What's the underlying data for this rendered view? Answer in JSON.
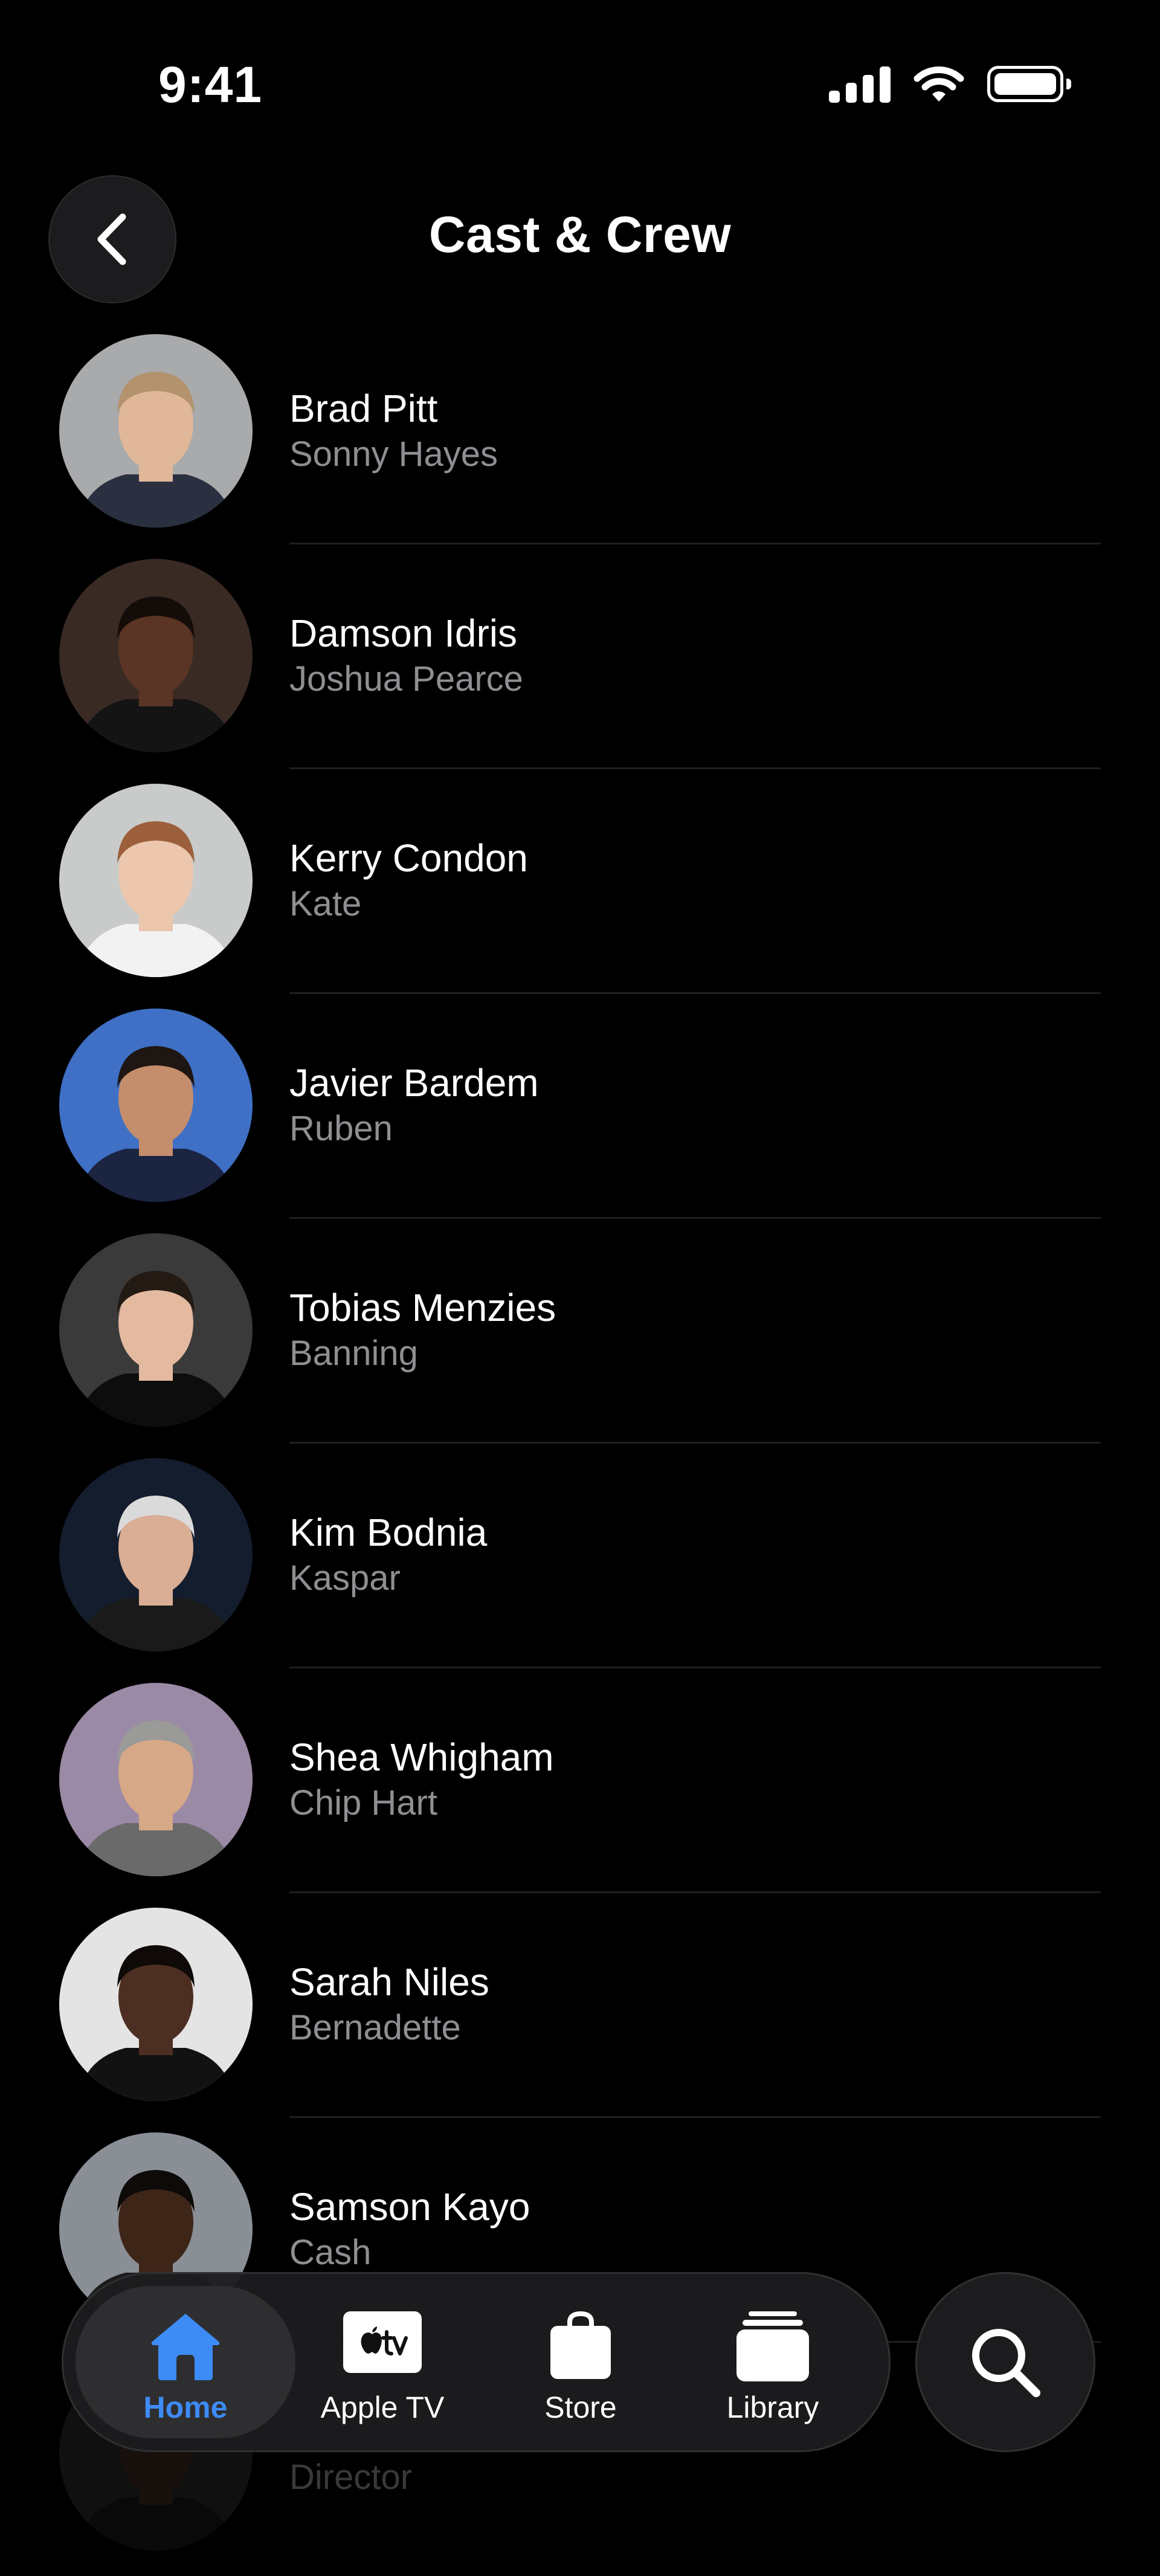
{
  "status_bar": {
    "time": "9:41"
  },
  "header": {
    "title": "Cast & Crew"
  },
  "cast": [
    {
      "name": "Brad Pitt",
      "role": "Sonny Hayes",
      "avatar_bg": "#a9aaac",
      "skin": "#e0b798",
      "hair": "#b3936e",
      "clothes": "#2a3040"
    },
    {
      "name": "Damson Idris",
      "role": "Joshua Pearce",
      "avatar_bg": "#3a2a24",
      "skin": "#5a3424",
      "hair": "#140c08",
      "clothes": "#141414"
    },
    {
      "name": "Kerry Condon",
      "role": "Kate",
      "avatar_bg": "#c8cbc9",
      "skin": "#ecc7ae",
      "hair": "#9c5f3c",
      "clothes": "#f2f2f2"
    },
    {
      "name": "Javier Bardem",
      "role": "Ruben",
      "avatar_bg": "#3f70c6",
      "skin": "#c48d6b",
      "hair": "#1e1612",
      "clothes": "#1b2440"
    },
    {
      "name": "Tobias Menzies",
      "role": "Banning",
      "avatar_bg": "#3a3a3a",
      "skin": "#e3b9a0",
      "hair": "#241a14",
      "clothes": "#0d0d0d"
    },
    {
      "name": "Kim Bodnia",
      "role": "Kaspar",
      "avatar_bg": "#141d2e",
      "skin": "#d9ae95",
      "hair": "#dadada",
      "clothes": "#1a1a1a"
    },
    {
      "name": "Shea Whigham",
      "role": "Chip Hart",
      "avatar_bg": "#9b8aa6",
      "skin": "#d6a888",
      "hair": "#9a9a98",
      "clothes": "#6a6a6a"
    },
    {
      "name": "Sarah Niles",
      "role": "Bernadette",
      "avatar_bg": "#e4e4e4",
      "skin": "#4d2e22",
      "hair": "#0f0a08",
      "clothes": "#121212"
    },
    {
      "name": "Samson Kayo",
      "role": "Cash",
      "avatar_bg": "#8a8f96",
      "skin": "#3d2518",
      "hair": "#0e0a08",
      "clothes": "#1b1b1b"
    },
    {
      "name": "",
      "role": "Director",
      "avatar_bg": "#2a2a2a",
      "skin": "#3a2a22",
      "hair": "#101010",
      "clothes": "#181818"
    }
  ],
  "tab_bar": {
    "tabs": [
      {
        "label": "Home",
        "icon": "house-icon",
        "active": true
      },
      {
        "label": "Apple TV",
        "icon": "apple-tv-icon",
        "active": false
      },
      {
        "label": "Store",
        "icon": "bag-icon",
        "active": false
      },
      {
        "label": "Library",
        "icon": "stack-icon",
        "active": false
      }
    ],
    "active_color": "#3d8bf5"
  },
  "search": {
    "icon": "magnifying-glass-icon"
  }
}
